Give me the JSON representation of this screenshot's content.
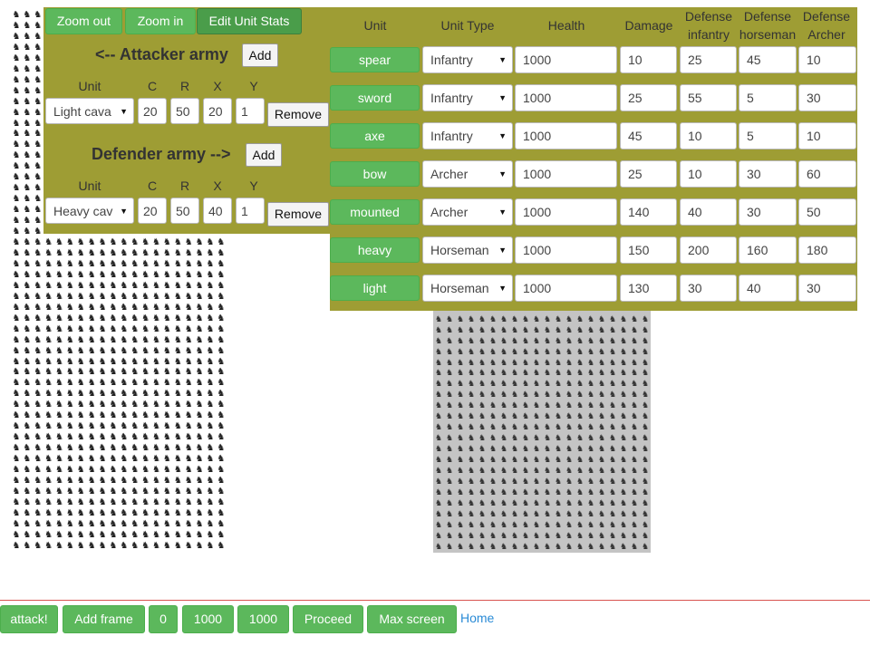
{
  "grid_icons": {
    "attacker": "horse-rider-icon",
    "defender": "horse-rider-icon"
  },
  "view_buttons": {
    "zoom_out": "Zoom out",
    "zoom_in": "Zoom in",
    "edit_stats": "Edit Unit Stats"
  },
  "attacker": {
    "title": "<-- Attacker army",
    "add_label": "Add",
    "col_unit": "Unit",
    "col_c": "C",
    "col_r": "R",
    "col_x": "X",
    "col_y": "Y",
    "unit": "Light cava",
    "c": "20",
    "r": "50",
    "x": "20",
    "y": "1",
    "remove_label": "Remove"
  },
  "defender": {
    "title": "Defender army -->",
    "add_label": "Add",
    "col_unit": "Unit",
    "col_c": "C",
    "col_r": "R",
    "col_x": "X",
    "col_y": "Y",
    "unit": "Heavy cav",
    "c": "20",
    "r": "50",
    "x": "40",
    "y": "1",
    "remove_label": "Remove"
  },
  "stats": {
    "headers": {
      "unit": "Unit",
      "type": "Unit Type",
      "health": "Health",
      "damage": "Damage",
      "def_inf_1": "Defense",
      "def_inf_2": "infantry",
      "def_hor_1": "Defense",
      "def_hor_2": "horseman",
      "def_arc_1": "Defense",
      "def_arc_2": "Archer"
    },
    "rows": [
      {
        "unit": "spear",
        "type": "Infantry",
        "health": "1000",
        "damage": "10",
        "def_inf": "25",
        "def_hor": "45",
        "def_arc": "10"
      },
      {
        "unit": "sword",
        "type": "Infantry",
        "health": "1000",
        "damage": "25",
        "def_inf": "55",
        "def_hor": "5",
        "def_arc": "30"
      },
      {
        "unit": "axe",
        "type": "Infantry",
        "health": "1000",
        "damage": "45",
        "def_inf": "10",
        "def_hor": "5",
        "def_arc": "10"
      },
      {
        "unit": "bow",
        "type": "Archer",
        "health": "1000",
        "damage": "25",
        "def_inf": "10",
        "def_hor": "30",
        "def_arc": "60"
      },
      {
        "unit": "mounted",
        "type": "Archer",
        "health": "1000",
        "damage": "140",
        "def_inf": "40",
        "def_hor": "30",
        "def_arc": "50"
      },
      {
        "unit": "heavy",
        "type": "Horseman",
        "health": "1000",
        "damage": "150",
        "def_inf": "200",
        "def_hor": "160",
        "def_arc": "180"
      },
      {
        "unit": "light",
        "type": "Horseman",
        "health": "1000",
        "damage": "130",
        "def_inf": "30",
        "def_hor": "40",
        "def_arc": "30"
      }
    ]
  },
  "toolbar": {
    "attack": "attack!",
    "add_frame": "Add frame",
    "frame_counter": "0",
    "value_a": "1000",
    "value_b": "1000",
    "proceed": "Proceed",
    "max_screen": "Max screen",
    "home": "Home"
  },
  "colors": {
    "button_green": "#5cb85c",
    "panel_olive": "#9e9d34",
    "link_blue": "#2a8bd6",
    "divider_red": "#d9534f"
  }
}
